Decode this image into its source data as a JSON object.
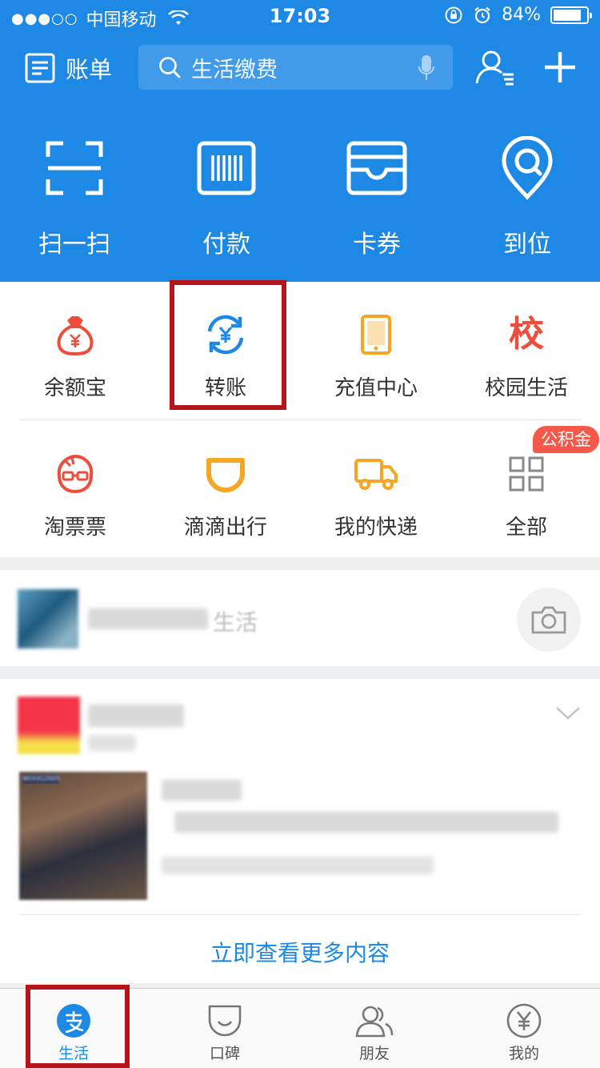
{
  "status_bar": {
    "signal": "●●●○○",
    "carrier": "中国移动",
    "time": "17:03",
    "battery": "84%",
    "battery_level": 0.84
  },
  "header": {
    "bill_label": "账单",
    "search_placeholder": "生活缴费"
  },
  "quick_actions": [
    {
      "label": "扫一扫",
      "icon": "scan-icon"
    },
    {
      "label": "付款",
      "icon": "barcode-pay-icon"
    },
    {
      "label": "卡券",
      "icon": "wallet-card-icon"
    },
    {
      "label": "到位",
      "icon": "location-pin-icon"
    }
  ],
  "services": [
    {
      "label": "余额宝",
      "icon": "money-bag-icon"
    },
    {
      "label": "转账",
      "icon": "transfer-icon"
    },
    {
      "label": "充值中心",
      "icon": "phone-recharge-icon"
    },
    {
      "label": "校园生活",
      "icon": "campus-icon",
      "glyph": "校"
    },
    {
      "label": "淘票票",
      "icon": "taopiaopiao-icon"
    },
    {
      "label": "滴滴出行",
      "icon": "didi-icon"
    },
    {
      "label": "我的快递",
      "icon": "delivery-truck-icon"
    },
    {
      "label": "全部",
      "icon": "grid-all-icon"
    }
  ],
  "badge": "公积金",
  "life_card": {
    "title_suffix": "生活"
  },
  "feed_card": {
    "thumbnail_tag": "WOOG2005",
    "more_link": "立即查看更多内容"
  },
  "tabbar": [
    {
      "label": "生活",
      "icon": "alipay-icon",
      "active": true
    },
    {
      "label": "口碑",
      "icon": "koubei-icon"
    },
    {
      "label": "朋友",
      "icon": "friends-icon"
    },
    {
      "label": "我的",
      "icon": "yuan-icon"
    }
  ],
  "colors": {
    "primary": "#1e88e5",
    "highlight_box": "#b5141a",
    "service_orange": "#f5a623",
    "service_red": "#ef4d3b",
    "badge": "#f6594a"
  }
}
